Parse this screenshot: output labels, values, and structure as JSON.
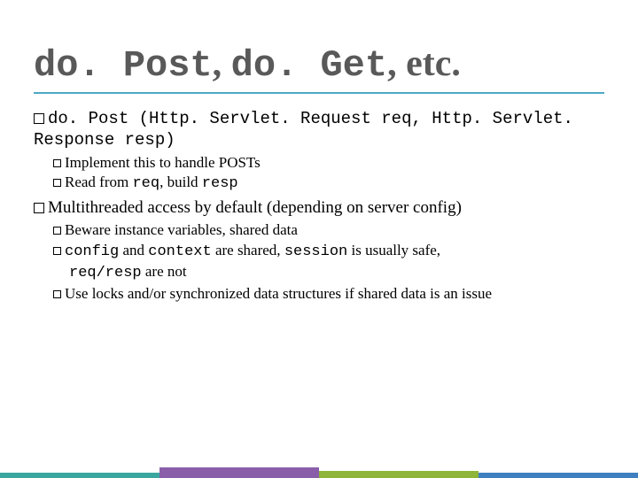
{
  "title": {
    "part1": "do. Post",
    "sep1": ", ",
    "part2": "do. Get",
    "sep2": ", etc."
  },
  "b1": {
    "line": "do. Post (Http. Servlet. Request req, Http. Servlet. Response resp)",
    "sub1a": "Implement this to handle POSTs",
    "sub2_pre": "Read from ",
    "sub2_req": "req",
    "sub2_mid": ", build ",
    "sub2_resp": "resp"
  },
  "b2": {
    "line": "Multithreaded access by default (depending on server config)",
    "sub1": "Beware instance variables, shared data",
    "sub2_a": "config",
    "sub2_b": " and ",
    "sub2_c": "context",
    "sub2_d": " are shared, ",
    "sub2_e": "session",
    "sub2_f": " is usually safe, ",
    "sub2_g": "req/resp",
    "sub2_h": " are not",
    "sub3": "Use locks and/or synchronized data structures if shared data is an issue"
  }
}
